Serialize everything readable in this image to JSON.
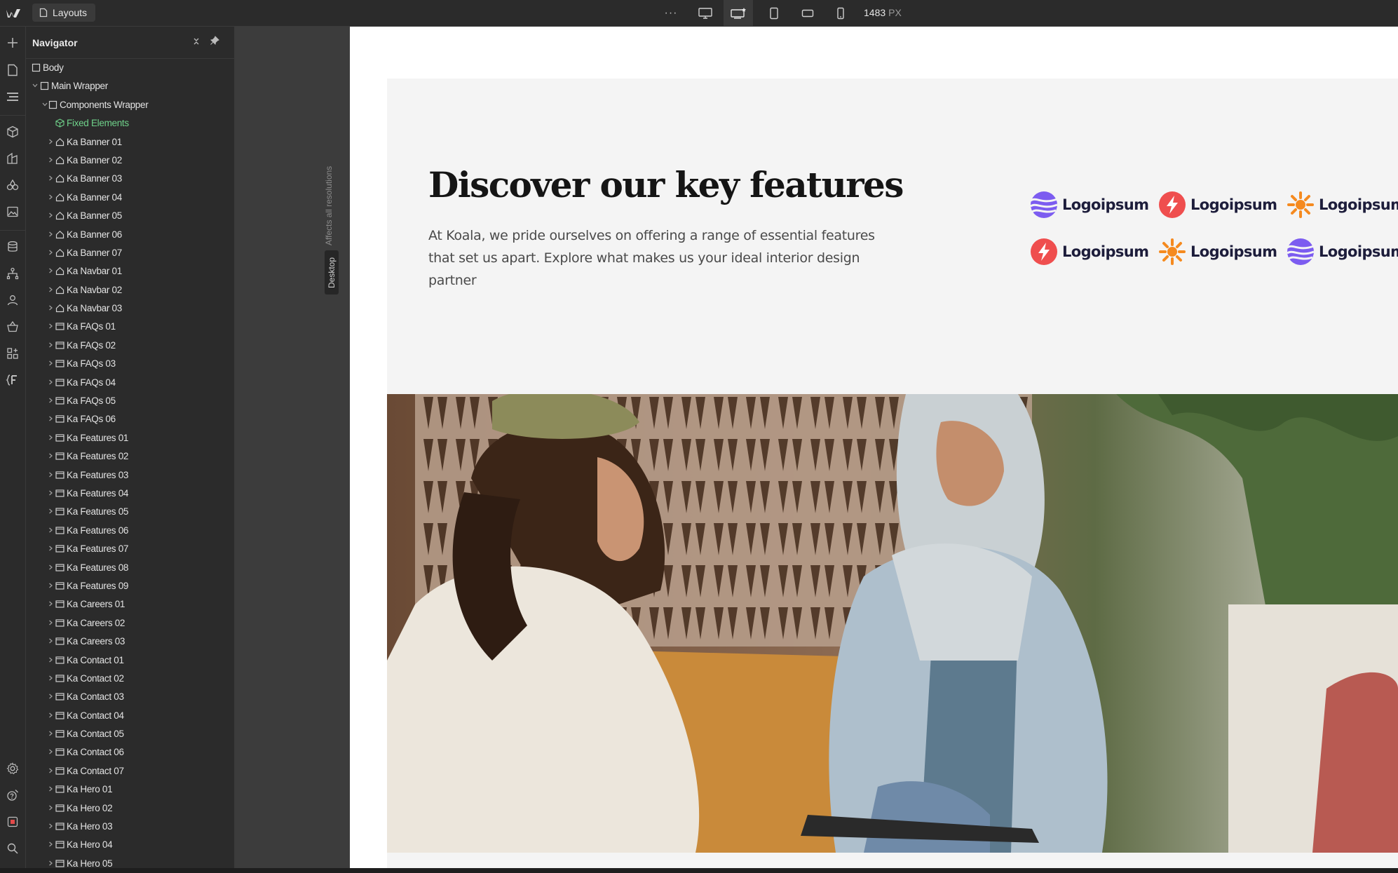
{
  "topbar": {
    "layouts_label": "Layouts",
    "more_label": "···",
    "width_value": "1483",
    "width_unit": "PX"
  },
  "navigator": {
    "title": "Navigator",
    "close_label": "×",
    "tree": [
      {
        "label": "Body",
        "depth": 0,
        "icon": "box",
        "chevron": false
      },
      {
        "label": "Main Wrapper",
        "depth": 1,
        "icon": "box",
        "chevron": "down"
      },
      {
        "label": "Components Wrapper",
        "depth": 2,
        "icon": "box",
        "chevron": "down"
      },
      {
        "label": "Fixed Elements",
        "depth": 3,
        "icon": "component",
        "chevron": false,
        "green": true
      },
      {
        "label": "Ka Banner 01",
        "depth": 3,
        "icon": "home",
        "chevron": "right"
      },
      {
        "label": "Ka Banner 02",
        "depth": 3,
        "icon": "home",
        "chevron": "right"
      },
      {
        "label": "Ka Banner 03",
        "depth": 3,
        "icon": "home",
        "chevron": "right"
      },
      {
        "label": "Ka Banner 04",
        "depth": 3,
        "icon": "home",
        "chevron": "right"
      },
      {
        "label": "Ka Banner 05",
        "depth": 3,
        "icon": "home",
        "chevron": "right"
      },
      {
        "label": "Ka Banner 06",
        "depth": 3,
        "icon": "home",
        "chevron": "right"
      },
      {
        "label": "Ka Banner 07",
        "depth": 3,
        "icon": "home",
        "chevron": "right"
      },
      {
        "label": "Ka Navbar 01",
        "depth": 3,
        "icon": "home",
        "chevron": "right"
      },
      {
        "label": "Ka Navbar 02",
        "depth": 3,
        "icon": "home",
        "chevron": "right"
      },
      {
        "label": "Ka Navbar 03",
        "depth": 3,
        "icon": "home",
        "chevron": "right"
      },
      {
        "label": "Ka FAQs 01",
        "depth": 3,
        "icon": "section",
        "chevron": "right"
      },
      {
        "label": "Ka FAQs 02",
        "depth": 3,
        "icon": "section",
        "chevron": "right"
      },
      {
        "label": "Ka FAQs 03",
        "depth": 3,
        "icon": "section",
        "chevron": "right"
      },
      {
        "label": "Ka FAQs 04",
        "depth": 3,
        "icon": "section",
        "chevron": "right"
      },
      {
        "label": "Ka FAQs 05",
        "depth": 3,
        "icon": "section",
        "chevron": "right"
      },
      {
        "label": "Ka FAQs 06",
        "depth": 3,
        "icon": "section",
        "chevron": "right"
      },
      {
        "label": "Ka Features 01",
        "depth": 3,
        "icon": "section",
        "chevron": "right"
      },
      {
        "label": "Ka Features 02",
        "depth": 3,
        "icon": "section",
        "chevron": "right"
      },
      {
        "label": "Ka Features 03",
        "depth": 3,
        "icon": "section",
        "chevron": "right"
      },
      {
        "label": "Ka Features 04",
        "depth": 3,
        "icon": "section",
        "chevron": "right"
      },
      {
        "label": "Ka Features 05",
        "depth": 3,
        "icon": "section",
        "chevron": "right"
      },
      {
        "label": "Ka Features 06",
        "depth": 3,
        "icon": "section",
        "chevron": "right"
      },
      {
        "label": "Ka Features 07",
        "depth": 3,
        "icon": "section",
        "chevron": "right"
      },
      {
        "label": "Ka Features 08",
        "depth": 3,
        "icon": "section",
        "chevron": "right"
      },
      {
        "label": "Ka Features 09",
        "depth": 3,
        "icon": "section",
        "chevron": "right"
      },
      {
        "label": "Ka Careers 01",
        "depth": 3,
        "icon": "section",
        "chevron": "right"
      },
      {
        "label": "Ka Careers 02",
        "depth": 3,
        "icon": "section",
        "chevron": "right"
      },
      {
        "label": "Ka Careers 03",
        "depth": 3,
        "icon": "section",
        "chevron": "right"
      },
      {
        "label": "Ka Contact 01",
        "depth": 3,
        "icon": "section",
        "chevron": "right"
      },
      {
        "label": "Ka Contact 02",
        "depth": 3,
        "icon": "section",
        "chevron": "right"
      },
      {
        "label": "Ka Contact 03",
        "depth": 3,
        "icon": "section",
        "chevron": "right"
      },
      {
        "label": "Ka Contact 04",
        "depth": 3,
        "icon": "section",
        "chevron": "right"
      },
      {
        "label": "Ka Contact 05",
        "depth": 3,
        "icon": "section",
        "chevron": "right"
      },
      {
        "label": "Ka Contact 06",
        "depth": 3,
        "icon": "section",
        "chevron": "right"
      },
      {
        "label": "Ka Contact 07",
        "depth": 3,
        "icon": "section",
        "chevron": "right"
      },
      {
        "label": "Ka Hero 01",
        "depth": 3,
        "icon": "section",
        "chevron": "right"
      },
      {
        "label": "Ka Hero 02",
        "depth": 3,
        "icon": "section",
        "chevron": "right"
      },
      {
        "label": "Ka Hero 03",
        "depth": 3,
        "icon": "section",
        "chevron": "right"
      },
      {
        "label": "Ka Hero 04",
        "depth": 3,
        "icon": "section",
        "chevron": "right"
      },
      {
        "label": "Ka Hero 05",
        "depth": 3,
        "icon": "section",
        "chevron": "right"
      }
    ]
  },
  "canvas": {
    "affects_label": "Affects all resolutions",
    "breakpoint_tab": "Desktop"
  },
  "page": {
    "headline": "Discover our key features",
    "subtext": "At Koala, we pride ourselves on offering a range of essential features that set us apart. Explore what makes us your ideal interior design partner",
    "logos": [
      {
        "name": "Logoipsum",
        "icon": "wave-logo-icon",
        "color": "#7c5cf0"
      },
      {
        "name": "Logoipsum",
        "icon": "bolt-logo-icon",
        "color": "#ef4e4e"
      },
      {
        "name": "Logoipsum",
        "icon": "sun-logo-icon",
        "color": "#f58a1f"
      },
      {
        "name": "Logoipsum",
        "icon": "bolt-logo-icon",
        "color": "#ef4e4e"
      },
      {
        "name": "Logoipsum",
        "icon": "sun-logo-icon",
        "color": "#f58a1f"
      },
      {
        "name": "Logoipsum",
        "icon": "wave-logo-icon",
        "color": "#7c5cf0"
      }
    ]
  },
  "colors": {
    "selected_green": "#6fd18a",
    "panel_bg": "#2b2b2b"
  }
}
